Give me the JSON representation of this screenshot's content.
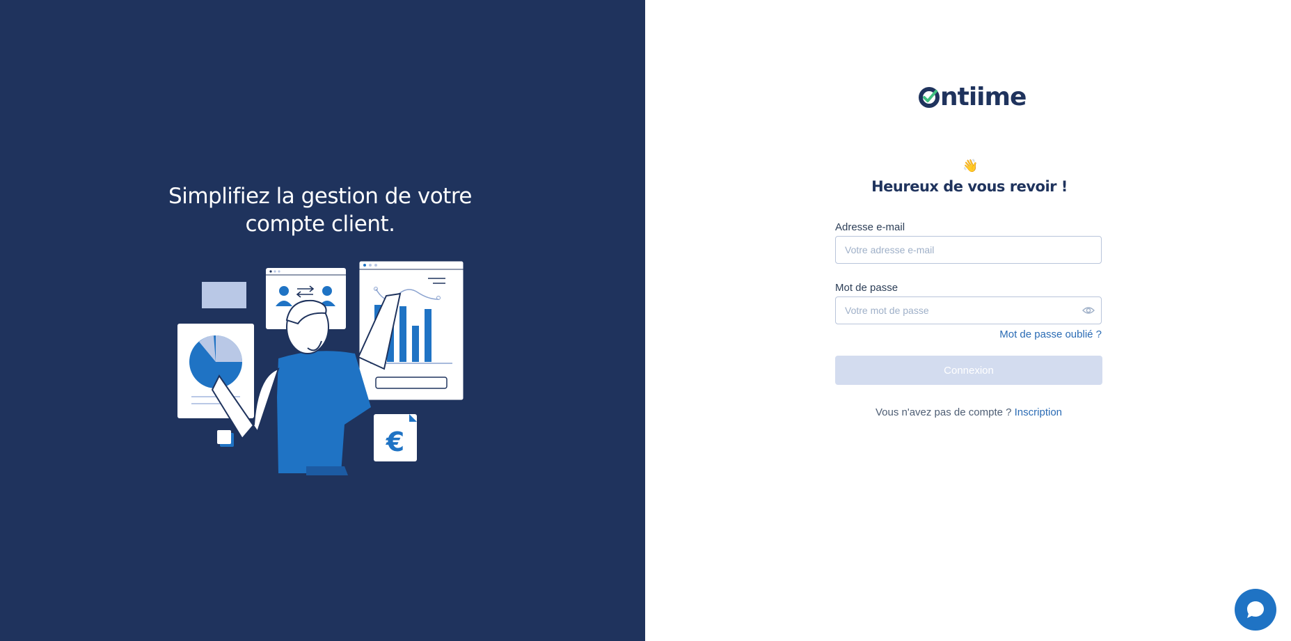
{
  "left": {
    "tagline": "Simplifiez la gestion de votre compte client."
  },
  "logo": {
    "text": "ntiime",
    "full": "Ontiime"
  },
  "welcome": {
    "emoji": "👋",
    "title": "Heureux de vous revoir !"
  },
  "form": {
    "email_label": "Adresse e-mail",
    "email_placeholder": "Votre adresse e-mail",
    "email_value": "",
    "password_label": "Mot de passe",
    "password_placeholder": "Votre mot de passe",
    "password_value": "",
    "forgot_label": "Mot de passe oublié ?",
    "submit_label": "Connexion"
  },
  "signup": {
    "prompt": "Vous n'avez pas de compte ?",
    "link": "Inscription"
  },
  "icons": {
    "eye": "eye-icon",
    "chat": "chat-bubble-icon",
    "logo_mark": "checkmark-o-logo"
  },
  "colors": {
    "panel_bg": "#1f335d",
    "accent": "#1f73c4",
    "link": "#2a6bb4",
    "button_disabled": "#d3dcef",
    "logo_check": "#3fbf7f"
  }
}
